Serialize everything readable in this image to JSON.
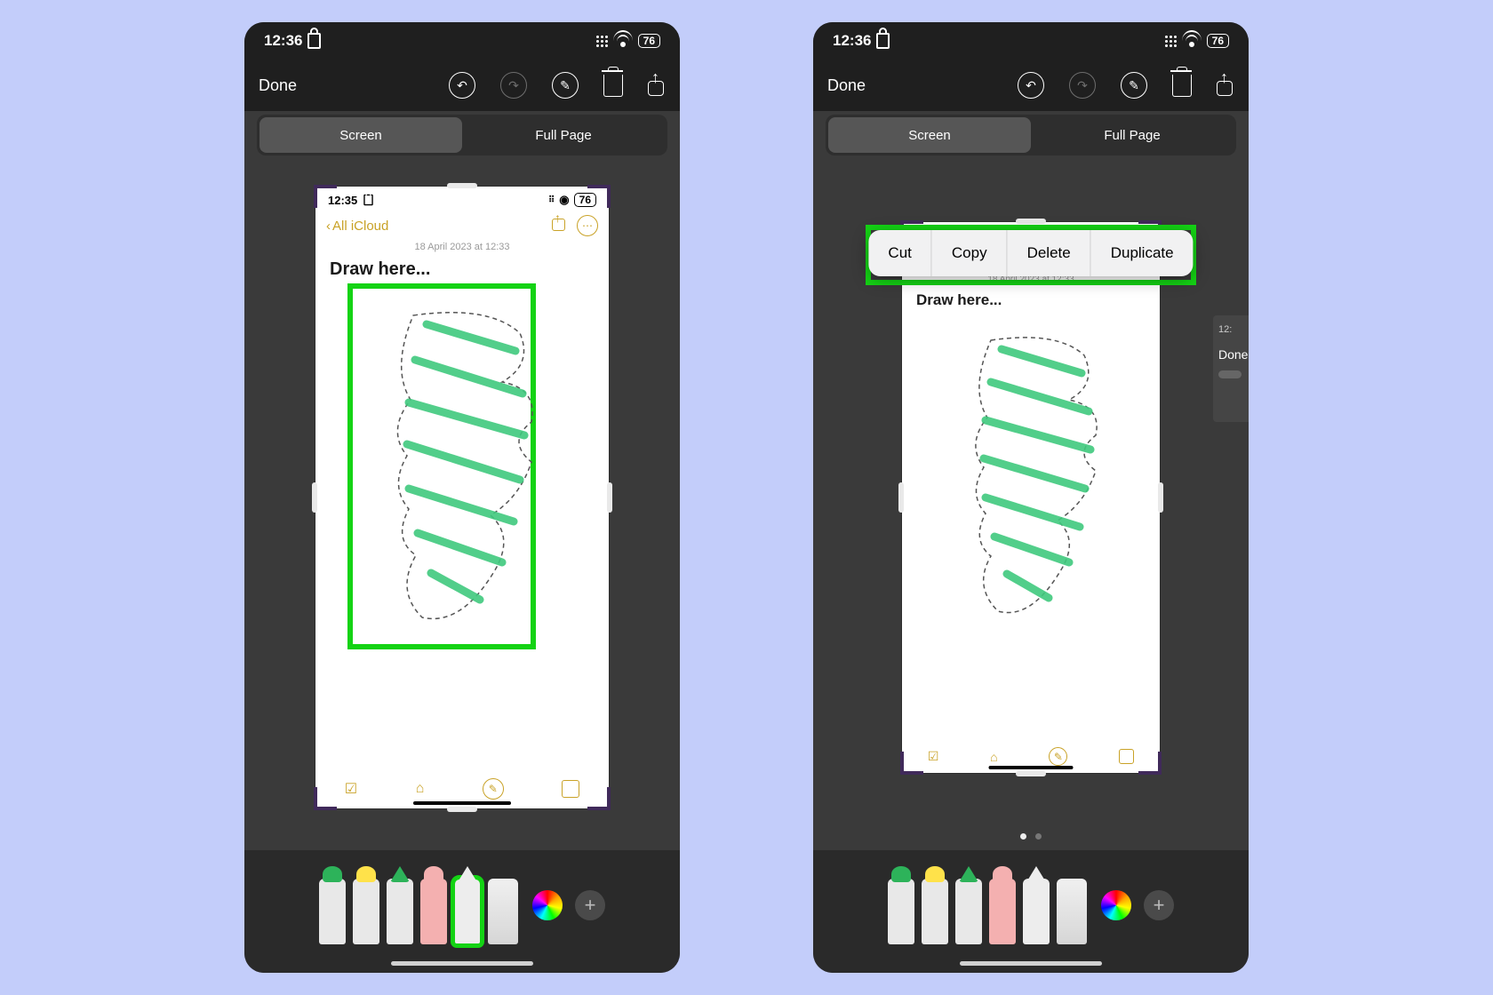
{
  "status": {
    "time": "12:36",
    "battery": "76"
  },
  "toolbar": {
    "done": "Done"
  },
  "seg": {
    "screen": "Screen",
    "fullpage": "Full Page"
  },
  "inner": {
    "time": "12:35",
    "battery": "76",
    "back": "All iCloud",
    "date": "18 April 2023 at 12:33",
    "title": "Draw here..."
  },
  "peek": {
    "time": "12:",
    "done": "Done"
  },
  "ctx": {
    "cut": "Cut",
    "copy": "Copy",
    "del": "Delete",
    "dup": "Duplicate"
  },
  "accent": "#14d314"
}
